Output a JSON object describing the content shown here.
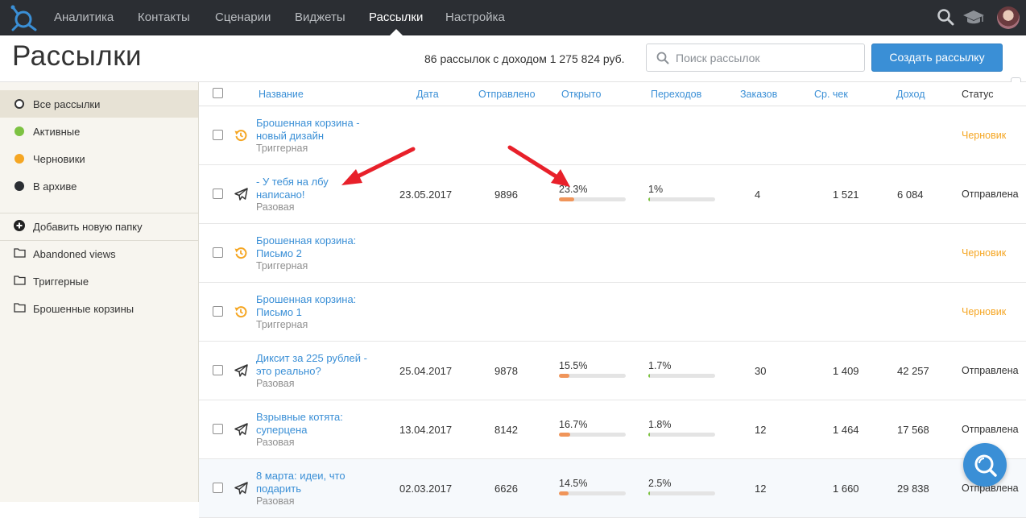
{
  "nav": {
    "items": [
      "Аналитика",
      "Контакты",
      "Сценарии",
      "Виджеты",
      "Рассылки",
      "Настройка"
    ],
    "active": "Рассылки"
  },
  "header": {
    "title": "Рассылки",
    "summary": "86 рассылок с доходом 1 275 824 руб.",
    "search_placeholder": "Поиск рассылок",
    "create_label": "Создать рассылку"
  },
  "sidebar": {
    "filters": [
      {
        "label": "Все рассылки",
        "color": "#ffffff",
        "active": true
      },
      {
        "label": "Активные",
        "color": "#7dc242"
      },
      {
        "label": "Черновики",
        "color": "#f5a623"
      },
      {
        "label": "В архиве",
        "color": "#2b2e33"
      }
    ],
    "add_folder": "Добавить новую папку",
    "folders": [
      "Abandoned views",
      "Триггерные",
      "Брошенные корзины"
    ]
  },
  "table": {
    "columns": {
      "name": "Название",
      "date": "Дата",
      "sent": "Отправлено",
      "opened": "Открыто",
      "clicks": "Переходов",
      "orders": "Заказов",
      "avg": "Ср. чек",
      "revenue": "Доход",
      "status": "Статус"
    },
    "rows": [
      {
        "name": "Брошенная корзина - новый дизайн",
        "type": "Триггерная",
        "kind": "trigger",
        "status": "Черновик",
        "draft": true
      },
      {
        "name": "- У тебя на лбу написано!",
        "type": "Разовая",
        "kind": "oneoff",
        "date": "23.05.2017",
        "sent": "9896",
        "opened": "23.3%",
        "opened_val": 0.233,
        "clicks": "1%",
        "clicks_val": 0.01,
        "orders": "4",
        "avg": "1 521",
        "revenue": "6 084",
        "status": "Отправлена"
      },
      {
        "name": "Брошенная корзина: Письмо 2",
        "type": "Триггерная",
        "kind": "trigger",
        "status": "Черновик",
        "draft": true
      },
      {
        "name": "Брошенная корзина: Письмо 1",
        "type": "Триггерная",
        "kind": "trigger",
        "status": "Черновик",
        "draft": true
      },
      {
        "name": "Диксит за 225 рублей - это реально?",
        "type": "Разовая",
        "kind": "oneoff",
        "date": "25.04.2017",
        "sent": "9878",
        "opened": "15.5%",
        "opened_val": 0.155,
        "clicks": "1.7%",
        "clicks_val": 0.017,
        "orders": "30",
        "avg": "1 409",
        "revenue": "42 257",
        "status": "Отправлена"
      },
      {
        "name": "Взрывные котята: суперцена",
        "type": "Разовая",
        "kind": "oneoff",
        "date": "13.04.2017",
        "sent": "8142",
        "opened": "16.7%",
        "opened_val": 0.167,
        "clicks": "1.8%",
        "clicks_val": 0.018,
        "orders": "12",
        "avg": "1 464",
        "revenue": "17 568",
        "status": "Отправлена"
      },
      {
        "name": "8 марта: идеи, что подарить",
        "type": "Разовая",
        "kind": "oneoff",
        "date": "02.03.2017",
        "sent": "6626",
        "opened": "14.5%",
        "opened_val": 0.145,
        "clicks": "2.5%",
        "clicks_val": 0.025,
        "orders": "12",
        "avg": "1 660",
        "revenue": "29 838",
        "status": "Отправлена"
      }
    ]
  },
  "colors": {
    "accent": "#3a8fd6",
    "draft": "#f5a623",
    "open_bar": "#f0955a",
    "click_bar": "#7dc242",
    "arrow": "#e8202a"
  }
}
